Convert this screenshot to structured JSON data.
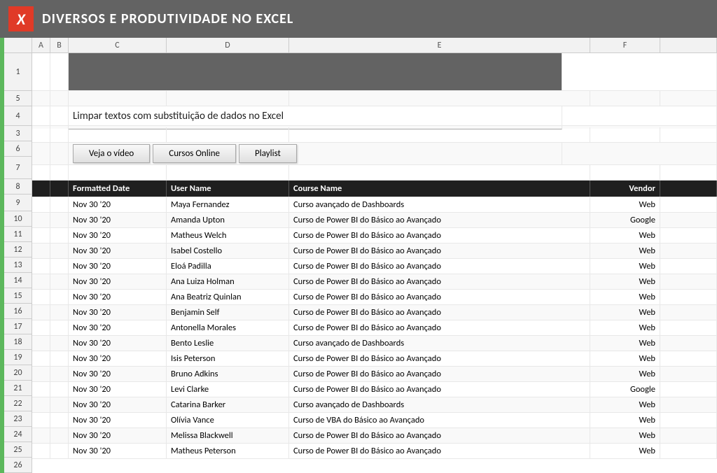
{
  "header": {
    "title": "DIVERSOS E PRODUTIVIDADE NO EXCEL",
    "logo_text": "X"
  },
  "subtitle": "Limpar textos com substituição de dados no Excel",
  "buttons": [
    {
      "label": "Veja o vídeo"
    },
    {
      "label": "Cursos Online"
    },
    {
      "label": "Playlist"
    }
  ],
  "col_headers_letters": [
    "A",
    "B",
    "C",
    "D",
    "E",
    "F"
  ],
  "row_numbers": [
    "1",
    "5",
    "4",
    "3",
    "6",
    "7",
    "8",
    "9",
    "10",
    "11",
    "12",
    "13",
    "14",
    "15",
    "16",
    "17",
    "18",
    "19",
    "20",
    "21",
    "22",
    "23",
    "24",
    "25",
    "26"
  ],
  "table_headers": [
    "Formatted Date",
    "User Name",
    "Course Name",
    "Vendor"
  ],
  "table_rows": [
    [
      "Nov 30 '20",
      "Maya Fernandez",
      "Curso avançado de Dashboards",
      "Web"
    ],
    [
      "Nov 30 '20",
      "Amanda Upton",
      "Curso de Power BI do Básico ao Avançado",
      "Google"
    ],
    [
      "Nov 30 '20",
      "Matheus Welch",
      "Curso de Power BI do Básico ao Avançado",
      "Web"
    ],
    [
      "Nov 30 '20",
      "Isabel Costello",
      "Curso de Power BI do Básico ao Avançado",
      "Web"
    ],
    [
      "Nov 30 '20",
      "Eloá Padilla",
      "Curso de Power BI do Básico ao Avançado",
      "Web"
    ],
    [
      "Nov 30 '20",
      "Ana Luiza Holman",
      "Curso de Power BI do Básico ao Avançado",
      "Web"
    ],
    [
      "Nov 30 '20",
      "Ana Beatriz Quinlan",
      "Curso de Power BI do Básico ao Avançado",
      "Web"
    ],
    [
      "Nov 30 '20",
      "Benjamin Self",
      "Curso de Power BI do Básico ao Avançado",
      "Web"
    ],
    [
      "Nov 30 '20",
      "Antonella Morales",
      "Curso de Power BI do Básico ao Avançado",
      "Web"
    ],
    [
      "Nov 30 '20",
      "Bento Leslie",
      "Curso avançado de Dashboards",
      "Web"
    ],
    [
      "Nov 30 '20",
      "Isis Peterson",
      "Curso de Power BI do Básico ao Avançado",
      "Web"
    ],
    [
      "Nov 30 '20",
      "Bruno Adkins",
      "Curso de Power BI do Básico ao Avançado",
      "Web"
    ],
    [
      "Nov 30 '20",
      "Levi Clarke",
      "Curso de Power BI do Básico ao Avançado",
      "Google"
    ],
    [
      "Nov 30 '20",
      "Catarina Barker",
      "Curso avançado de Dashboards",
      "Web"
    ],
    [
      "Nov 30 '20",
      "Olívia Vance",
      "Curso de VBA do Básico ao Avançado",
      "Web"
    ],
    [
      "Nov 30 '20",
      "Melissa Blackwell",
      "Curso de Power BI do Básico ao Avançado",
      "Web"
    ],
    [
      "Nov 30 '20",
      "Matheus Peterson",
      "Curso de Power BI do Básico ao Avançado",
      "Web"
    ]
  ]
}
